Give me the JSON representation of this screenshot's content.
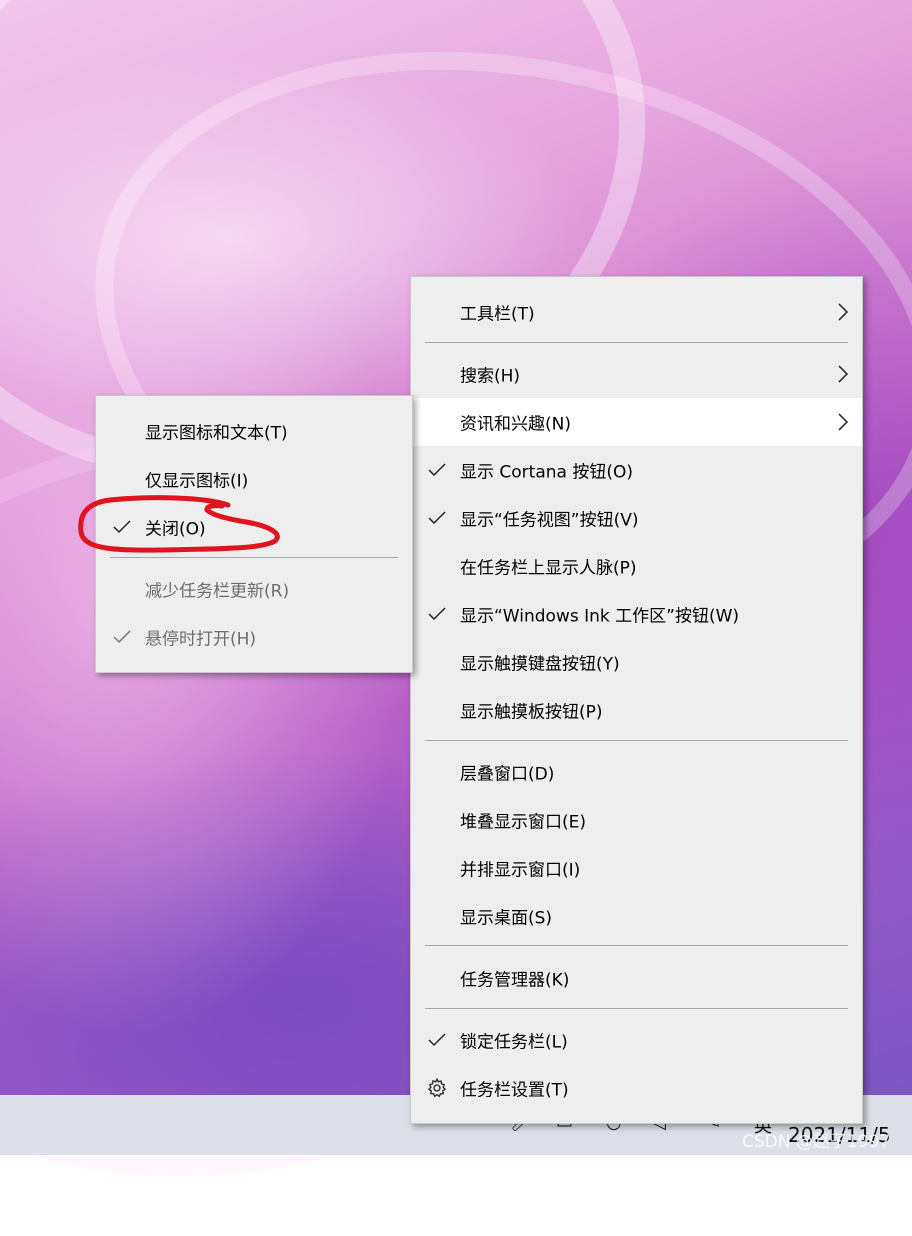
{
  "main_menu": {
    "items": [
      {
        "label": "工具栏(T)",
        "submenu": true
      },
      {
        "label": "搜索(H)",
        "submenu": true
      },
      {
        "label": "资讯和兴趣(N)",
        "submenu": true,
        "highlighted": true
      },
      {
        "label": "显示 Cortana 按钮(O)",
        "checked": true
      },
      {
        "label": "显示“任务视图”按钮(V)",
        "checked": true
      },
      {
        "label": "在任务栏上显示人脉(P)"
      },
      {
        "label": "显示“Windows Ink 工作区”按钮(W)",
        "checked": true
      },
      {
        "label": "显示触摸键盘按钮(Y)"
      },
      {
        "label": "显示触摸板按钮(P)"
      },
      {
        "label": "层叠窗口(D)"
      },
      {
        "label": "堆叠显示窗口(E)"
      },
      {
        "label": "并排显示窗口(I)"
      },
      {
        "label": "显示桌面(S)"
      },
      {
        "label": "任务管理器(K)"
      },
      {
        "label": "锁定任务栏(L)",
        "checked": true
      },
      {
        "label": "任务栏设置(T)",
        "icon": "gear-icon"
      }
    ]
  },
  "sub_menu": {
    "items": [
      {
        "label": "显示图标和文本(T)"
      },
      {
        "label": "仅显示图标(I)"
      },
      {
        "label": "关闭(O)",
        "checked": true
      },
      {
        "label": "减少任务栏更新(R)",
        "disabled": true
      },
      {
        "label": "悬停时打开(H)",
        "checked": true,
        "disabled": true
      }
    ]
  },
  "taskbar": {
    "ime_label": "英",
    "clock": "2021/11/5"
  },
  "watermark": "CSDN @赵子1997",
  "colors": {
    "menu_bg": "#eeeeee",
    "highlight_bg": "#ffffff",
    "disabled_text": "#6d6d6d",
    "annotation": "#e0141e"
  }
}
